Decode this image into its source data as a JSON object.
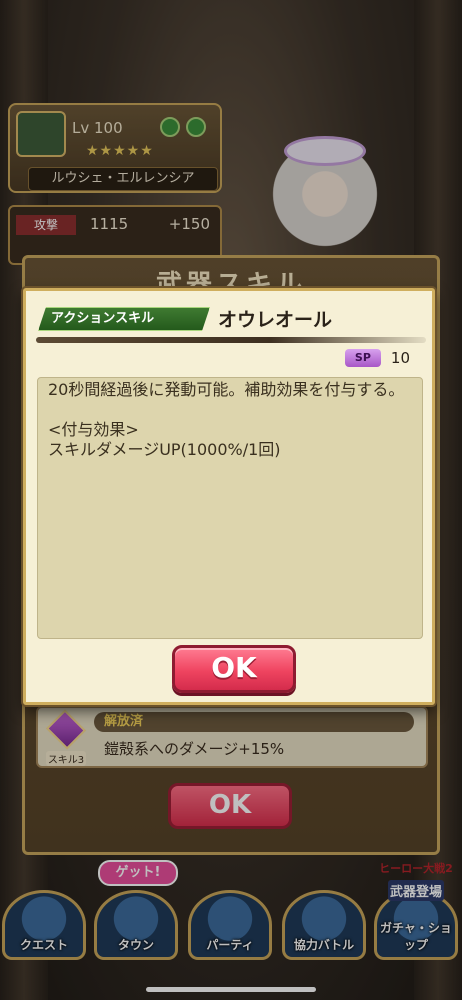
{
  "character": {
    "level": "Lv 100",
    "stars": "★★★★★",
    "name": "ルウシェ・エルレンシア"
  },
  "stats": {
    "attack_label": "攻撃",
    "attack_value": "1115",
    "attack_bonus": "+150"
  },
  "back_panel": {
    "title": "武器スキル",
    "unlock_status": "解放済",
    "skill_badge": "スキル3",
    "unlock_desc": "鎧殻系へのダメージ+15%",
    "ok_label": "OK"
  },
  "modal": {
    "skill_type": "アクションスキル",
    "skill_name": "オウレオール",
    "sp_label": "SP",
    "sp_value": "10",
    "description": "20秒間経過後に発動可能。補助効果を付与する。\n\n<付与効果>\nスキルダメージUP(1000%/1回)",
    "ok_label": "OK"
  },
  "nav": {
    "quest": "クエスト",
    "town": "タウン",
    "party": "パーティ",
    "coop": "協力バトル",
    "gacha": "ガチャ・ショップ",
    "get_badge": "ゲット!",
    "event_line1": "ヒーロー大戦2",
    "event_line2": "武器登場"
  },
  "colors": {
    "accent_ok": "#ef4460",
    "frame_gold": "#cfae5e",
    "skill_tag_green": "#2f6a24",
    "sp_purple": "#b866d6"
  }
}
